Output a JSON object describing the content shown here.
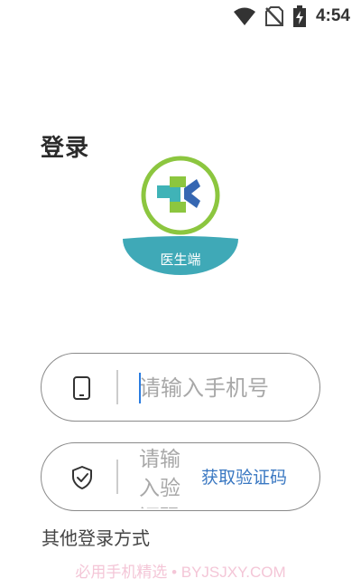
{
  "status_bar": {
    "time": "4:54",
    "icons": [
      "wifi-icon",
      "no-sim-icon",
      "battery-charging-icon"
    ]
  },
  "page": {
    "title": "登录"
  },
  "logo": {
    "caption": "医生端",
    "colors": {
      "ring": "#8cc63f",
      "green": "#8cc63f",
      "teal": "#40b3b7",
      "blue": "#3667b2",
      "banner": "#3fa9b7"
    }
  },
  "phone_field": {
    "icon": "phone-icon",
    "placeholder": "请输入手机号"
  },
  "code_field": {
    "icon": "shield-check-icon",
    "placeholder": "请输入验证码",
    "get_code_label": "获取验证码"
  },
  "other_login": {
    "label": "其他登录方式"
  },
  "watermark": {
    "text": "必用手机精选 • BYJSJXY.COM"
  },
  "colors": {
    "accent": "#3a78c2",
    "caret": "#2a7ce0",
    "border": "#8a8a8a"
  }
}
